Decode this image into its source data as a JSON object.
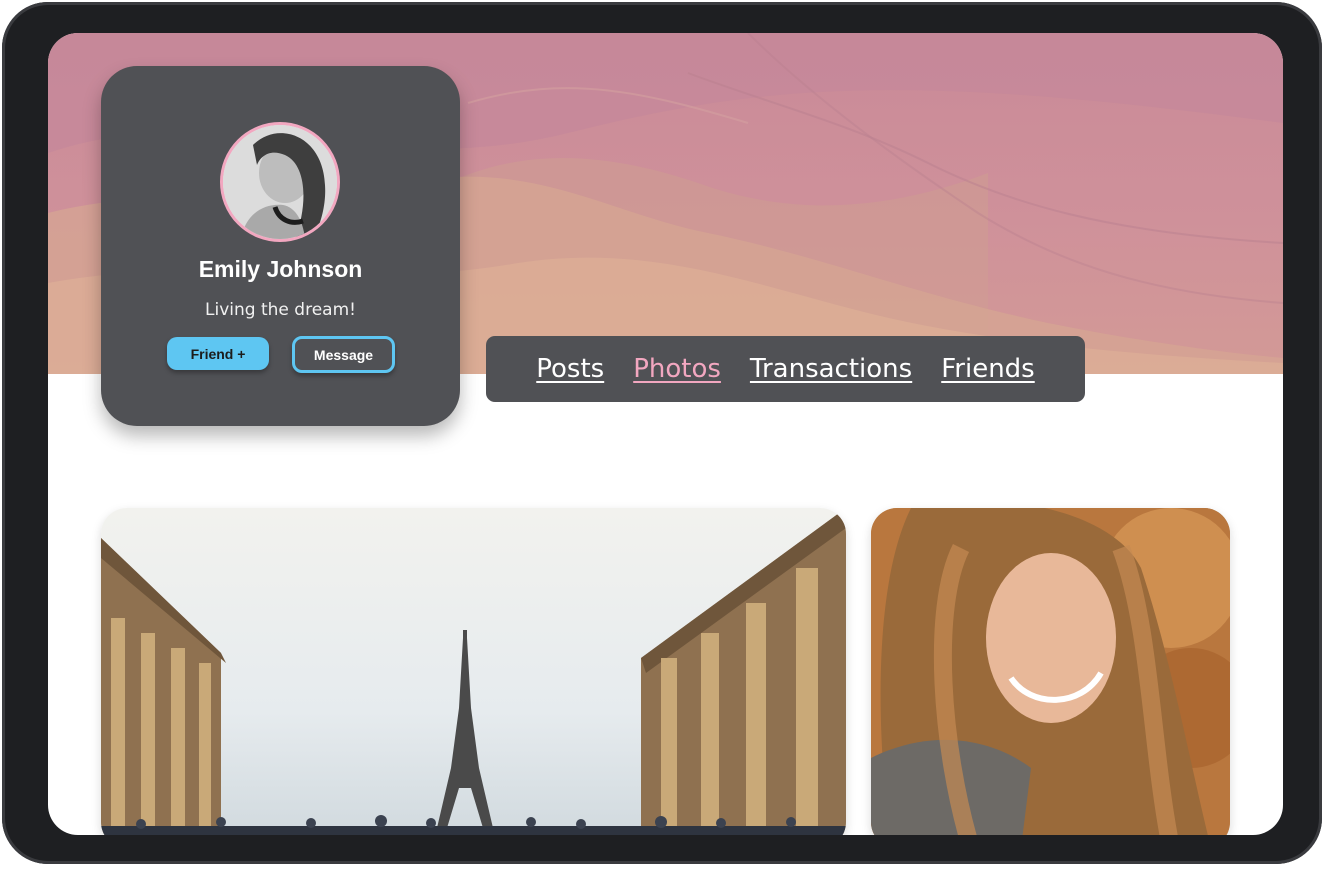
{
  "profile": {
    "name": "Emily Johnson",
    "tagline": "Living the dream!",
    "friend_button": "Friend +",
    "message_button": "Message"
  },
  "tabs": [
    {
      "label": "Posts",
      "active": false
    },
    {
      "label": "Photos",
      "active": true
    },
    {
      "label": "Transactions",
      "active": false
    },
    {
      "label": "Friends",
      "active": false
    }
  ],
  "colors": {
    "card_bg": "#505155",
    "accent_pink": "#f2a7c0",
    "accent_blue": "#5ec6f2",
    "cover_pink": "#c98a98"
  },
  "photos": [
    {
      "subject": "eiffel-tower"
    },
    {
      "subject": "woman-portrait"
    }
  ]
}
